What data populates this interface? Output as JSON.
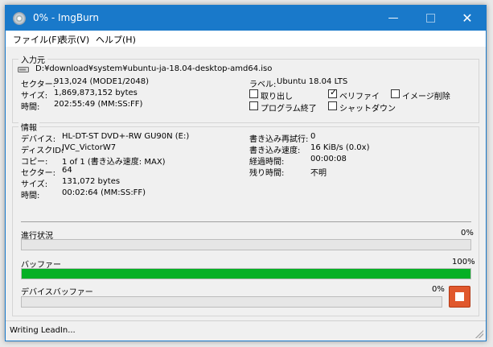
{
  "window": {
    "title": "0% - ImgBurn",
    "min_icon": "minimize-icon",
    "max_icon": "maximize-icon",
    "close_icon": "close-icon",
    "min_glyph": "—",
    "close_glyph": "✕"
  },
  "menu": [
    "ファイル(F)",
    "表示(V)",
    "ヘルプ(H)"
  ],
  "source": {
    "title": "入力元",
    "file_path": "D:¥download¥system¥ubuntu-ja-18.04-desktop-amd64.iso",
    "rows": [
      {
        "label": "セクター:",
        "value": "913,024 (MODE1/2048)"
      },
      {
        "label": "サイズ:",
        "value": "1,869,873,152 bytes"
      },
      {
        "label": "時間:",
        "value": "202:55:49 (MM:SS:FF)"
      }
    ],
    "volume_label_key": "ラベル:",
    "volume_label_value": "Ubuntu 18.04 LTS",
    "options": [
      {
        "label": "取り出し",
        "checked": false
      },
      {
        "label": "ベリファイ",
        "checked": true
      },
      {
        "label": "イメージ削除",
        "checked": false
      },
      {
        "label": "プログラム終了",
        "checked": false
      },
      {
        "label": "シャットダウン",
        "checked": false
      }
    ],
    "check_glyph": "✓"
  },
  "info": {
    "title": "情報",
    "left": [
      {
        "label": "デバイス:",
        "value": "HL-DT-ST DVD+-RW GU90N (E:)"
      },
      {
        "label": "ディスクID:",
        "value": "JVC_VictorW7"
      },
      {
        "label": "コピー:",
        "value": "1 of 1 (書き込み速度: MAX)"
      },
      {
        "label": "セクター:",
        "value": "64"
      },
      {
        "label": "サイズ:",
        "value": "131,072 bytes"
      },
      {
        "label": "時間:",
        "value": "00:02:64 (MM:SS:FF)"
      }
    ],
    "right": [
      {
        "label": "書き込み再試行:",
        "value": "0"
      },
      {
        "label": "書き込み速度:",
        "value": "16 KiB/s (0.0x)"
      },
      {
        "label": "経過時間:",
        "value": "00:00:08"
      },
      {
        "label": "残り時間:",
        "value": "不明"
      }
    ]
  },
  "progress": {
    "overall_label": "進行状況",
    "overall_percent_text": "0%",
    "overall_value": 0,
    "buffer_label": "バッファー",
    "buffer_percent_text": "100%",
    "buffer_value": 100,
    "device_buffer_label": "デバイスバッファー",
    "device_buffer_percent_text": "0%",
    "device_buffer_value": 0,
    "fill_color": "#06b025"
  },
  "stop_icon": "stop-icon",
  "status": "Writing LeadIn..."
}
